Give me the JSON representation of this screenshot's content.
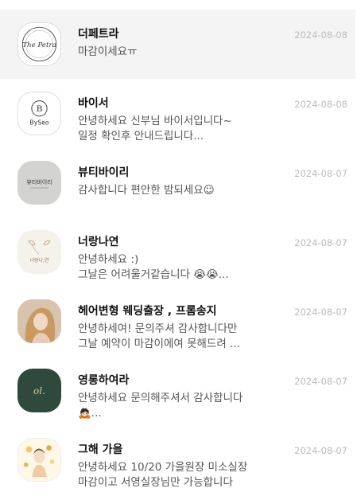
{
  "chats": [
    {
      "name": "더페트라",
      "preview": "마감이세요ㅠ",
      "date": "2024-08-08",
      "avatar_text": "The Petra"
    },
    {
      "name": "바이서",
      "preview": "안녕하세요 신부님 바이서입니다~\n일정 확인후 안내드립니다...",
      "date": "2024-08-08",
      "avatar_text": "BySeo"
    },
    {
      "name": "뷰티바이리",
      "preview": "감사합니다 편안한 밤되세요☺",
      "date": "2024-08-07",
      "avatar_text": "뷰티바이리"
    },
    {
      "name": "너랑나연",
      "preview": "안녕하세요 :)\n그날은 어려울거같습니다 😭😭...",
      "date": "2024-08-07",
      "avatar_text": "너랑나,연"
    },
    {
      "name": "헤어변형 웨딩출장 , 프롬송지",
      "preview": "안녕하세여! 문의주셔 감사합니다만\n그날 예약이 마감이에여  못해드려 ...",
      "date": "2024-08-07",
      "avatar_text": ""
    },
    {
      "name": "영롱하여라",
      "preview": "안녕하세요 문의해주셔서 감사합니다\n🙇🏻...",
      "date": "2024-08-07",
      "avatar_text": "ol."
    },
    {
      "name": "그해 가을",
      "preview": "안녕하세요 10/20 가을원장 미소실장\n마감이고 서영실장님만 가능합니다",
      "date": "2024-08-07",
      "avatar_text": ""
    }
  ]
}
